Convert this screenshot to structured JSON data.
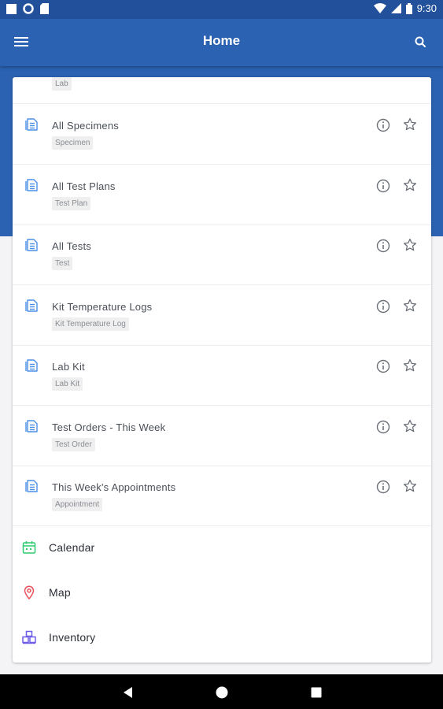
{
  "status_bar": {
    "time": "9:30",
    "left_icons": [
      "square-icon",
      "circle-icon",
      "sd-card-icon"
    ],
    "right_icons": [
      "wifi-icon",
      "signal-icon",
      "battery-icon"
    ]
  },
  "app_bar": {
    "title": "Home",
    "menu_icon": "hamburger-menu-icon",
    "search_icon": "search-icon"
  },
  "list": {
    "partial_row": {
      "tag": "Lab"
    },
    "rows": [
      {
        "title": "All Specimens",
        "tag": "Specimen"
      },
      {
        "title": "All Test Plans",
        "tag": "Test Plan"
      },
      {
        "title": "All Tests",
        "tag": "Test"
      },
      {
        "title": "Kit Temperature Logs",
        "tag": "Kit Temperature Log"
      },
      {
        "title": "Lab Kit",
        "tag": "Lab Kit"
      },
      {
        "title": "Test Orders - This Week",
        "tag": "Test Order"
      },
      {
        "title": "This Week's Appointments",
        "tag": "Appointment"
      }
    ]
  },
  "nav_items": [
    {
      "label": "Calendar",
      "icon": "calendar-icon",
      "color": "#2ecc71"
    },
    {
      "label": "Map",
      "icon": "map-pin-icon",
      "color": "#e8505b"
    },
    {
      "label": "Inventory",
      "icon": "inventory-boxes-icon",
      "color": "#6c5ce7"
    }
  ],
  "colors": {
    "primary": "#2b62b1",
    "status_bar": "#22509a",
    "list_icon": "#4a8fe7"
  }
}
